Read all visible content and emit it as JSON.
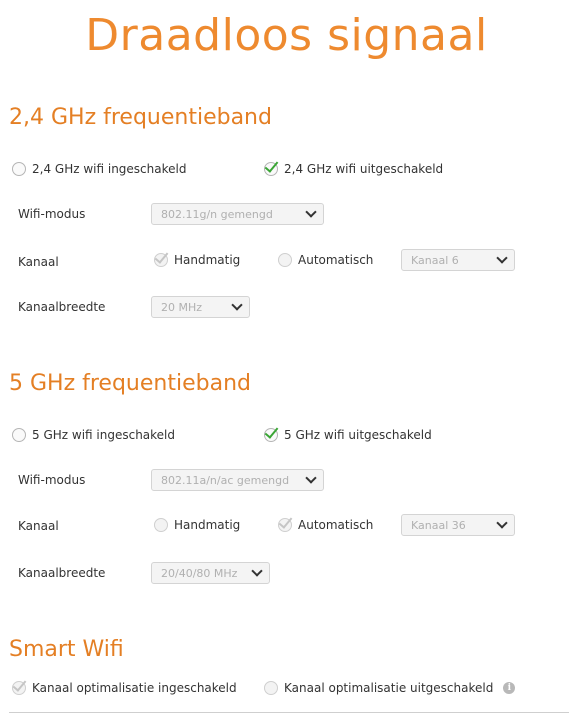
{
  "page_title": "Draadloos signaal",
  "band24": {
    "title": "2,4 GHz frequentieband",
    "enabled_label": "2,4 GHz wifi ingeschakeld",
    "disabled_label": "2,4 GHz wifi uitgeschakeld",
    "state": "disabled",
    "wifi_mode_label": "Wifi-modus",
    "wifi_mode_value": "802.11g/n gemengd",
    "channel_label": "Kanaal",
    "channel_manual_label": "Handmatig",
    "channel_auto_label": "Automatisch",
    "channel_mode": "manual",
    "channel_value": "Kanaal 6",
    "bandwidth_label": "Kanaalbreedte",
    "bandwidth_value": "20 MHz"
  },
  "band5": {
    "title": "5 GHz frequentieband",
    "enabled_label": "5 GHz wifi ingeschakeld",
    "disabled_label": "5 GHz wifi uitgeschakeld",
    "state": "disabled",
    "wifi_mode_label": "Wifi-modus",
    "wifi_mode_value": "802.11a/n/ac gemengd",
    "channel_label": "Kanaal",
    "channel_manual_label": "Handmatig",
    "channel_auto_label": "Automatisch",
    "channel_mode": "automatic",
    "channel_value": "Kanaal 36",
    "bandwidth_label": "Kanaalbreedte",
    "bandwidth_value": "20/40/80 MHz"
  },
  "smart_wifi": {
    "title": "Smart Wifi",
    "enabled_label": "Kanaal optimalisatie ingeschakeld",
    "disabled_label": "Kanaal optimalisatie uitgeschakeld",
    "state": "enabled",
    "info_icon": "info-icon"
  },
  "colors": {
    "title_orange": "#ee8a2f",
    "check_green": "#3aa535",
    "disabled_gray": "#b0b0b0"
  }
}
